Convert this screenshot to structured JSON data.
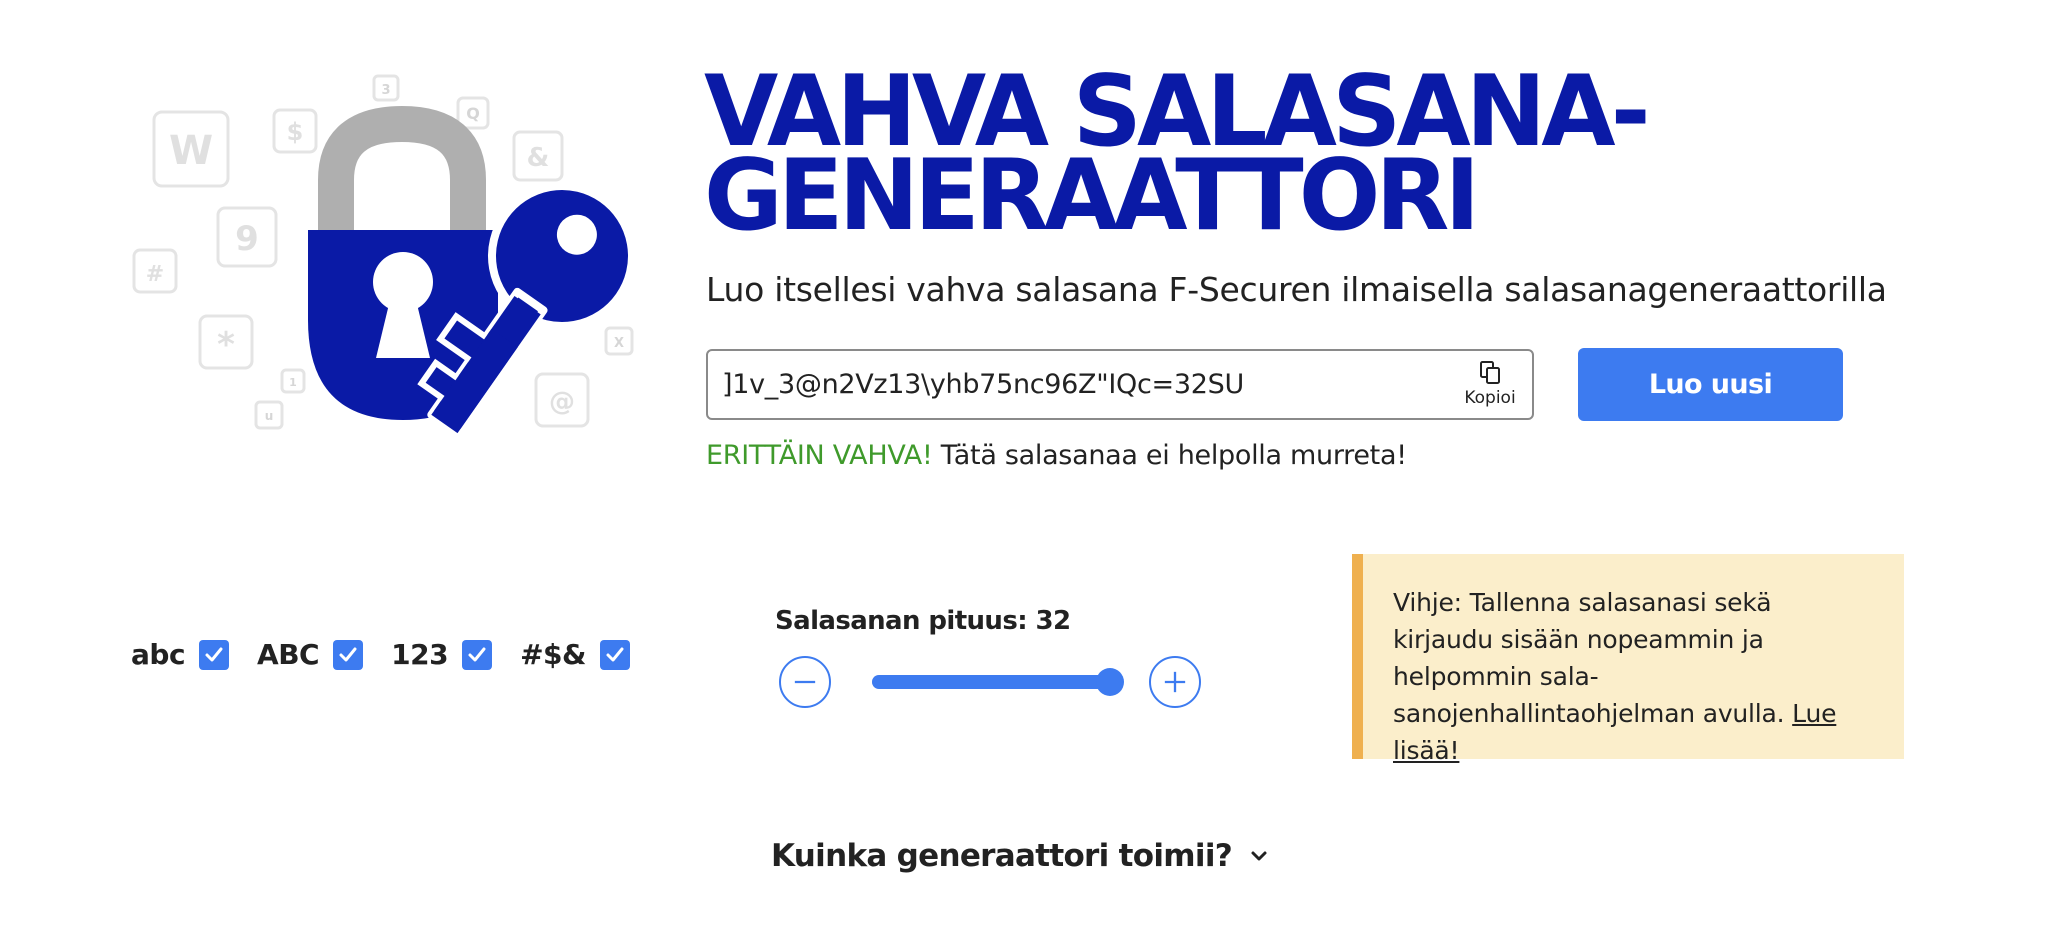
{
  "hero": {
    "title_line1": "VAHVA SALASANA-",
    "title_line2": "GENERAATTORI",
    "subtitle": "Luo itsellesi vahva salasana F-Securen ilmaisella salasanageneraattorilla"
  },
  "illustration": {
    "tile_chars": [
      "W",
      "$",
      "3",
      "Q",
      "&",
      "9",
      "#",
      "*",
      "1",
      "u",
      "@",
      "X"
    ]
  },
  "password": {
    "value": "]1v_3@n2Vz13\\yhb75nc96Z\"IQc=32SU",
    "copy_label": "Kopioi",
    "copy_icon": "copy-icon"
  },
  "generate_button": {
    "label": "Luo uusi"
  },
  "strength": {
    "label": "ERITTÄIN VAHVA!",
    "message": " Tätä salasanaa ei helpolla murreta!"
  },
  "options": [
    {
      "label": "abc",
      "checked": true
    },
    {
      "label": "ABC",
      "checked": true
    },
    {
      "label": "123",
      "checked": true
    },
    {
      "label": "#$&",
      "checked": true
    }
  ],
  "length": {
    "title": "Salasanan pituus: 32",
    "value": 32,
    "fill_fraction": 1.0
  },
  "tip": {
    "text": "Vihje: Tallenna salasanasi sekä kirjaudu sisään nopeammin ja helpommin sala-sanojenhallintaohjelman avulla. ",
    "link": "Lue lisää!"
  },
  "faq": {
    "label": "Kuinka generaattori toimii?"
  },
  "colors": {
    "brand_blue": "#0A1AA6",
    "accent_blue": "#3D7BF0",
    "success_green": "#3F9A2B",
    "tip_background": "#FBEECB",
    "tip_border": "#EFB04F",
    "lock_shackle_gray": "#AFAFAF"
  }
}
